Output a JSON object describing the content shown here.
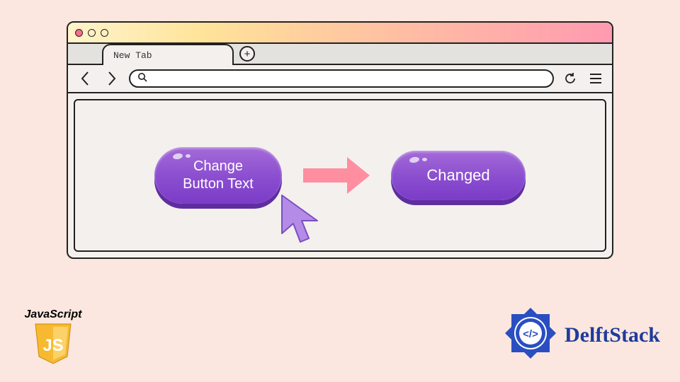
{
  "tab": {
    "label": "New Tab",
    "new_tab_icon": "+"
  },
  "buttons": {
    "before": "Change\nButton Text",
    "after": "Changed"
  },
  "badges": {
    "js_text": "JavaScript",
    "js_shield": "JS",
    "delft": "DelftStack"
  }
}
